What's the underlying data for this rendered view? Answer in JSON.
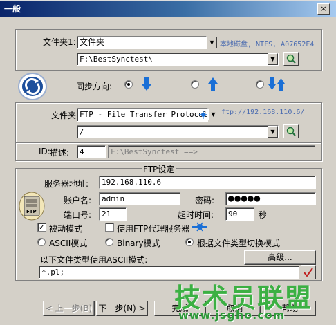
{
  "window": {
    "title": "一般",
    "close_glyph": "×",
    "background_snippet": "……"
  },
  "source": {
    "label": "文件夹1:",
    "type_value": "文件夹",
    "path_value": "F:\\BestSynctest\\",
    "info": "本地磁盘, NTFS, A07652F4"
  },
  "direction": {
    "label": "同步方向:"
  },
  "target": {
    "label": "文件夹",
    "type_value": "FTP - File Transfer Protocol",
    "url": "ftp://192.168.110.6/",
    "path_value": "/"
  },
  "id": {
    "label": "ID:",
    "desc_label": "描述:",
    "value": "4",
    "description": "F:\\BestSynctest ==>"
  },
  "ftp": {
    "group_title": "FTP设定",
    "server_label": "服务器地址:",
    "server_value": "192.168.110.6",
    "account_label": "账户名:",
    "account_value": "admin",
    "password_label": "密码:",
    "password_value": "●●●●●",
    "port_label": "端口号:",
    "port_value": "21",
    "timeout_label": "超时时间:",
    "timeout_value": "90",
    "timeout_unit": "秒",
    "passive_label": "被动模式",
    "passive_checked": true,
    "proxy_label": "使用FTP代理服务器",
    "proxy_checked": false,
    "mode_ascii": "ASCII模式",
    "mode_binary": "Binary模式",
    "mode_auto": "根据文件类型切换模式",
    "ascii_types_label": "以下文件类型使用ASCII模式:",
    "advanced_button": "高级...",
    "ascii_types_value": "*.pl;",
    "ftp_icon_text": "FTP"
  },
  "buttons": {
    "back": "< 上一步(B)",
    "next": "下一步(N) >",
    "finish": "完成",
    "cancel": "取消",
    "help": "帮助"
  },
  "watermark": {
    "main": "技术员联盟",
    "sub": "www.jsgho.com"
  },
  "colors": {
    "title_start": "#0a246a",
    "title_end": "#a6caf0",
    "arrow_blue": "#1a6fd6",
    "watermark": "#3cb043"
  }
}
